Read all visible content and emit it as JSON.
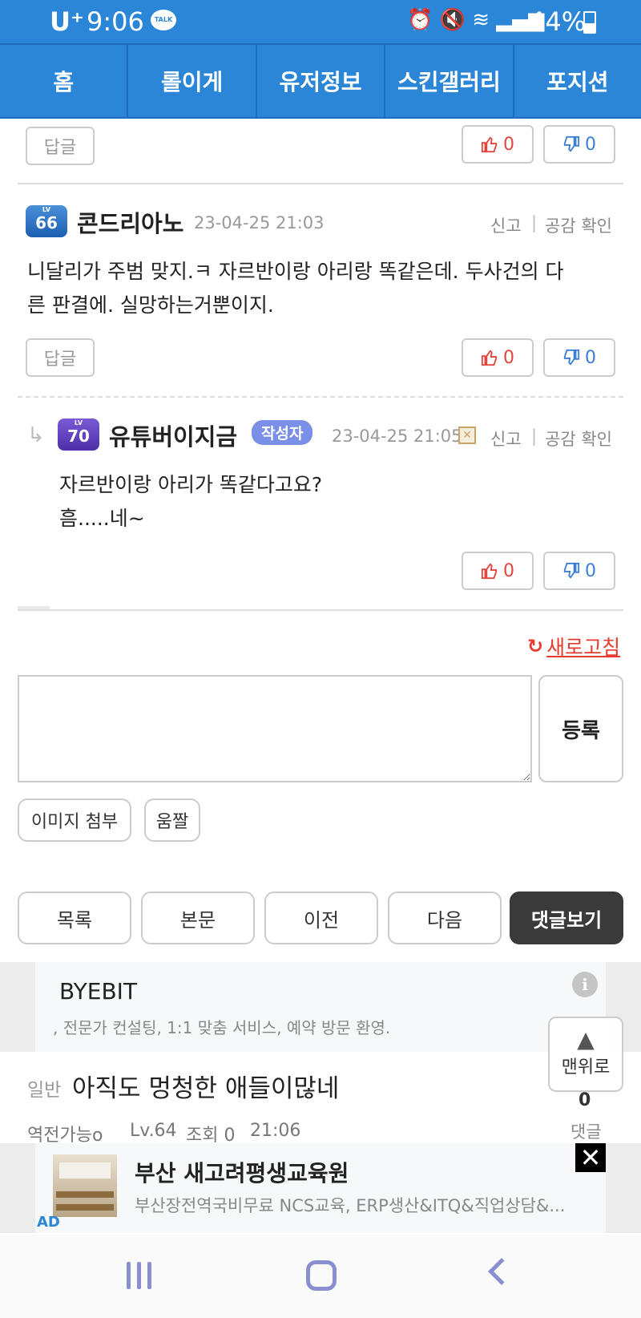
{
  "status_bar": {
    "carrier": "U⁺",
    "time": "9:06",
    "talk_badge": "TALK",
    "battery": "44%"
  },
  "nav": {
    "tabs": [
      "홈",
      "롤이게",
      "유저정보",
      "스킨갤러리",
      "포지션"
    ]
  },
  "comments": [
    {
      "reply_label": "답글",
      "up": "0",
      "down": "0"
    },
    {
      "level_label": "LV",
      "level": "66",
      "nickname": "콘드리아노",
      "datetime": "23-04-25 21:03",
      "report": "신고",
      "separator": "|",
      "like_check": "공감 확인",
      "text_line1": "니달리가 주범 맞지.ㅋ 자르반이랑 아리랑 똑같은데. 두사건의 다",
      "text_line2": "른 판결에. 실망하는거뿐이지.",
      "reply_label": "답글",
      "up": "0",
      "down": "0"
    },
    {
      "level_label": "LV",
      "level": "70",
      "nickname": "유튜버이지금",
      "author_tag": "작성자",
      "datetime": "23-04-25 21:05",
      "report": "신고",
      "separator": "|",
      "like_check": "공감 확인",
      "text_line1": "자르반이랑 아리가 똑같다고요?",
      "text_line2": "흠.....네~",
      "up": "0",
      "down": "0"
    }
  ],
  "refresh_label": "새로고침",
  "comment_form": {
    "submit_label": "등록",
    "attach_image": "이미지 첨부",
    "emoticon": "움짤"
  },
  "post_nav": {
    "list": "목록",
    "body": "본문",
    "prev": "이전",
    "next": "다음",
    "view_comments": "댓글보기"
  },
  "ad_top": {
    "title": "BYEBIT",
    "desc": ", 전문가 컨설팅, 1:1 맞춤 서비스, 예약 방문 환영."
  },
  "next_post": {
    "category": "일반",
    "title": "아직도 멍청한 애들이많네",
    "author": "역전가능o",
    "level": "Lv.64",
    "views": "조회 0",
    "time": "21:06",
    "comment_count": "0",
    "comment_label": "댓글"
  },
  "to_top": {
    "arrow": "▲",
    "label": "맨위로"
  },
  "ad_bottom": {
    "title": "부산 새고려평생교육원",
    "desc": "부산장전역국비무료 NCS교육, ERP생산&ITQ&직업상담&...",
    "ad_label": "AD",
    "close": "✕"
  },
  "colors": {
    "header_blue": "#2c86d8",
    "up_red": "#e0463d",
    "down_blue": "#3a7fd5",
    "refresh_red": "#e53c2f"
  }
}
